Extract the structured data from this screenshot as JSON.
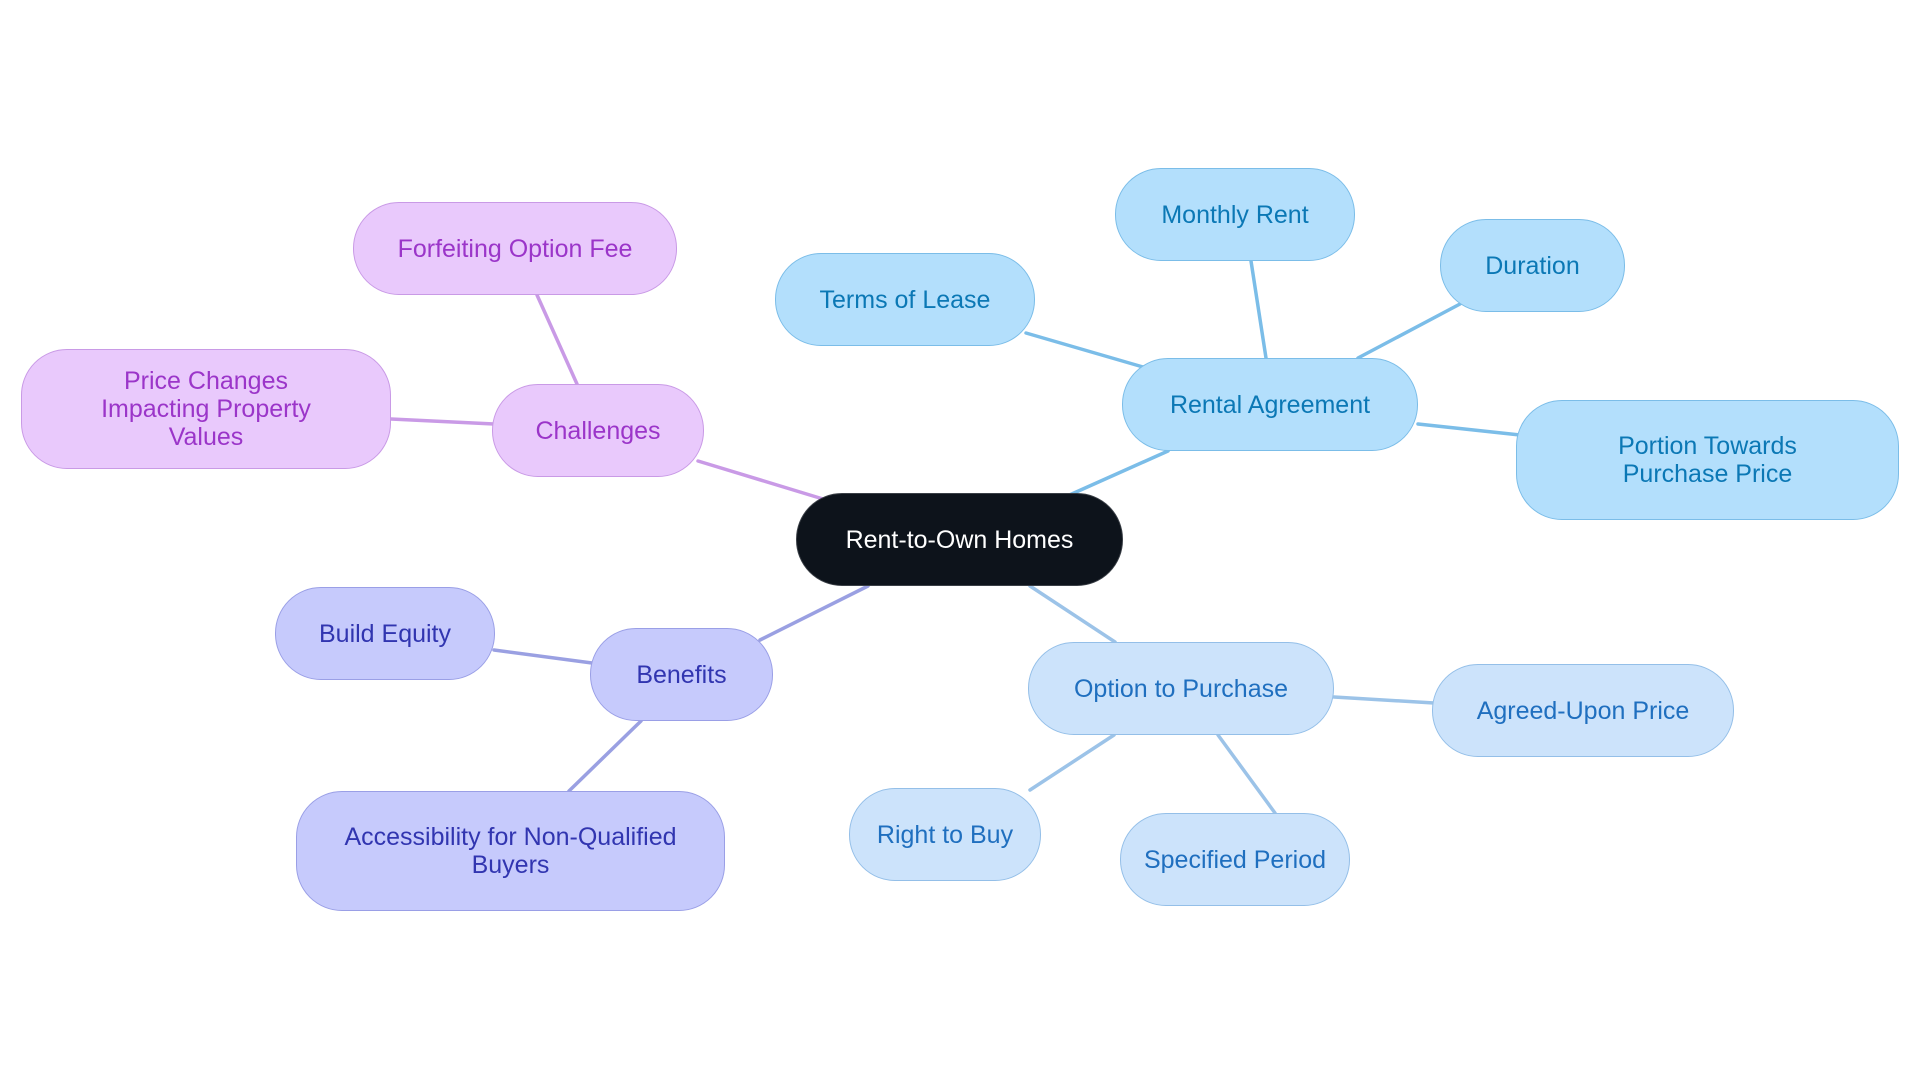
{
  "diagram": {
    "type": "mindmap",
    "root": {
      "id": "root",
      "label": "Rent-to-Own Homes"
    },
    "branches": [
      {
        "id": "rental",
        "label": "Rental Agreement",
        "color": "#b3dffc",
        "edge_color": "#7bbde8",
        "children": [
          {
            "id": "terms",
            "label": "Terms of Lease"
          },
          {
            "id": "monthly",
            "label": "Monthly Rent"
          },
          {
            "id": "duration",
            "label": "Duration"
          },
          {
            "id": "portion",
            "label": "Portion Towards Purchase Price"
          }
        ]
      },
      {
        "id": "option",
        "label": "Option to Purchase",
        "color": "#cce3fb",
        "edge_color": "#9cc3e8",
        "children": [
          {
            "id": "agreed",
            "label": "Agreed-Upon Price"
          },
          {
            "id": "right",
            "label": "Right to Buy"
          },
          {
            "id": "period",
            "label": "Specified Period"
          }
        ]
      },
      {
        "id": "challenges",
        "label": "Challenges",
        "color": "#e9c9fc",
        "edge_color": "#c99ae6",
        "children": [
          {
            "id": "forfeit",
            "label": "Forfeiting Option Fee"
          },
          {
            "id": "price",
            "label": "Price Changes Impacting Property Values"
          }
        ]
      },
      {
        "id": "benefits",
        "label": "Benefits",
        "color": "#c6cafc",
        "edge_color": "#9aa0e2",
        "children": [
          {
            "id": "equity",
            "label": "Build Equity"
          },
          {
            "id": "access",
            "label": "Accessibility for Non-Qualified Buyers"
          }
        ]
      }
    ]
  }
}
